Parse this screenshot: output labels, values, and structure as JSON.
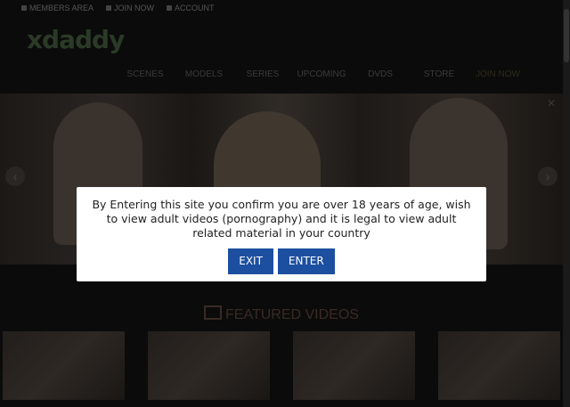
{
  "topbar": {
    "items": [
      "MEMBERS AREA",
      "JOIN NOW",
      "ACCOUNT"
    ]
  },
  "logo": {
    "text": "xdaddy"
  },
  "nav": {
    "items": [
      "SCENES",
      "MODELS",
      "SERIES",
      "UPCOMING",
      "DVDS",
      "STORE",
      "JOIN NOW"
    ]
  },
  "featured": {
    "title": "FEATURED VIDEOS"
  },
  "modal": {
    "message": "By Entering this site you confirm you are over 18 years of age, wish to view adult videos (pornography) and it is legal to view adult related material in your country",
    "exit_label": "EXIT",
    "enter_label": "ENTER"
  },
  "colors": {
    "button": "#1c4fa0",
    "background": "#0b0b0b"
  }
}
